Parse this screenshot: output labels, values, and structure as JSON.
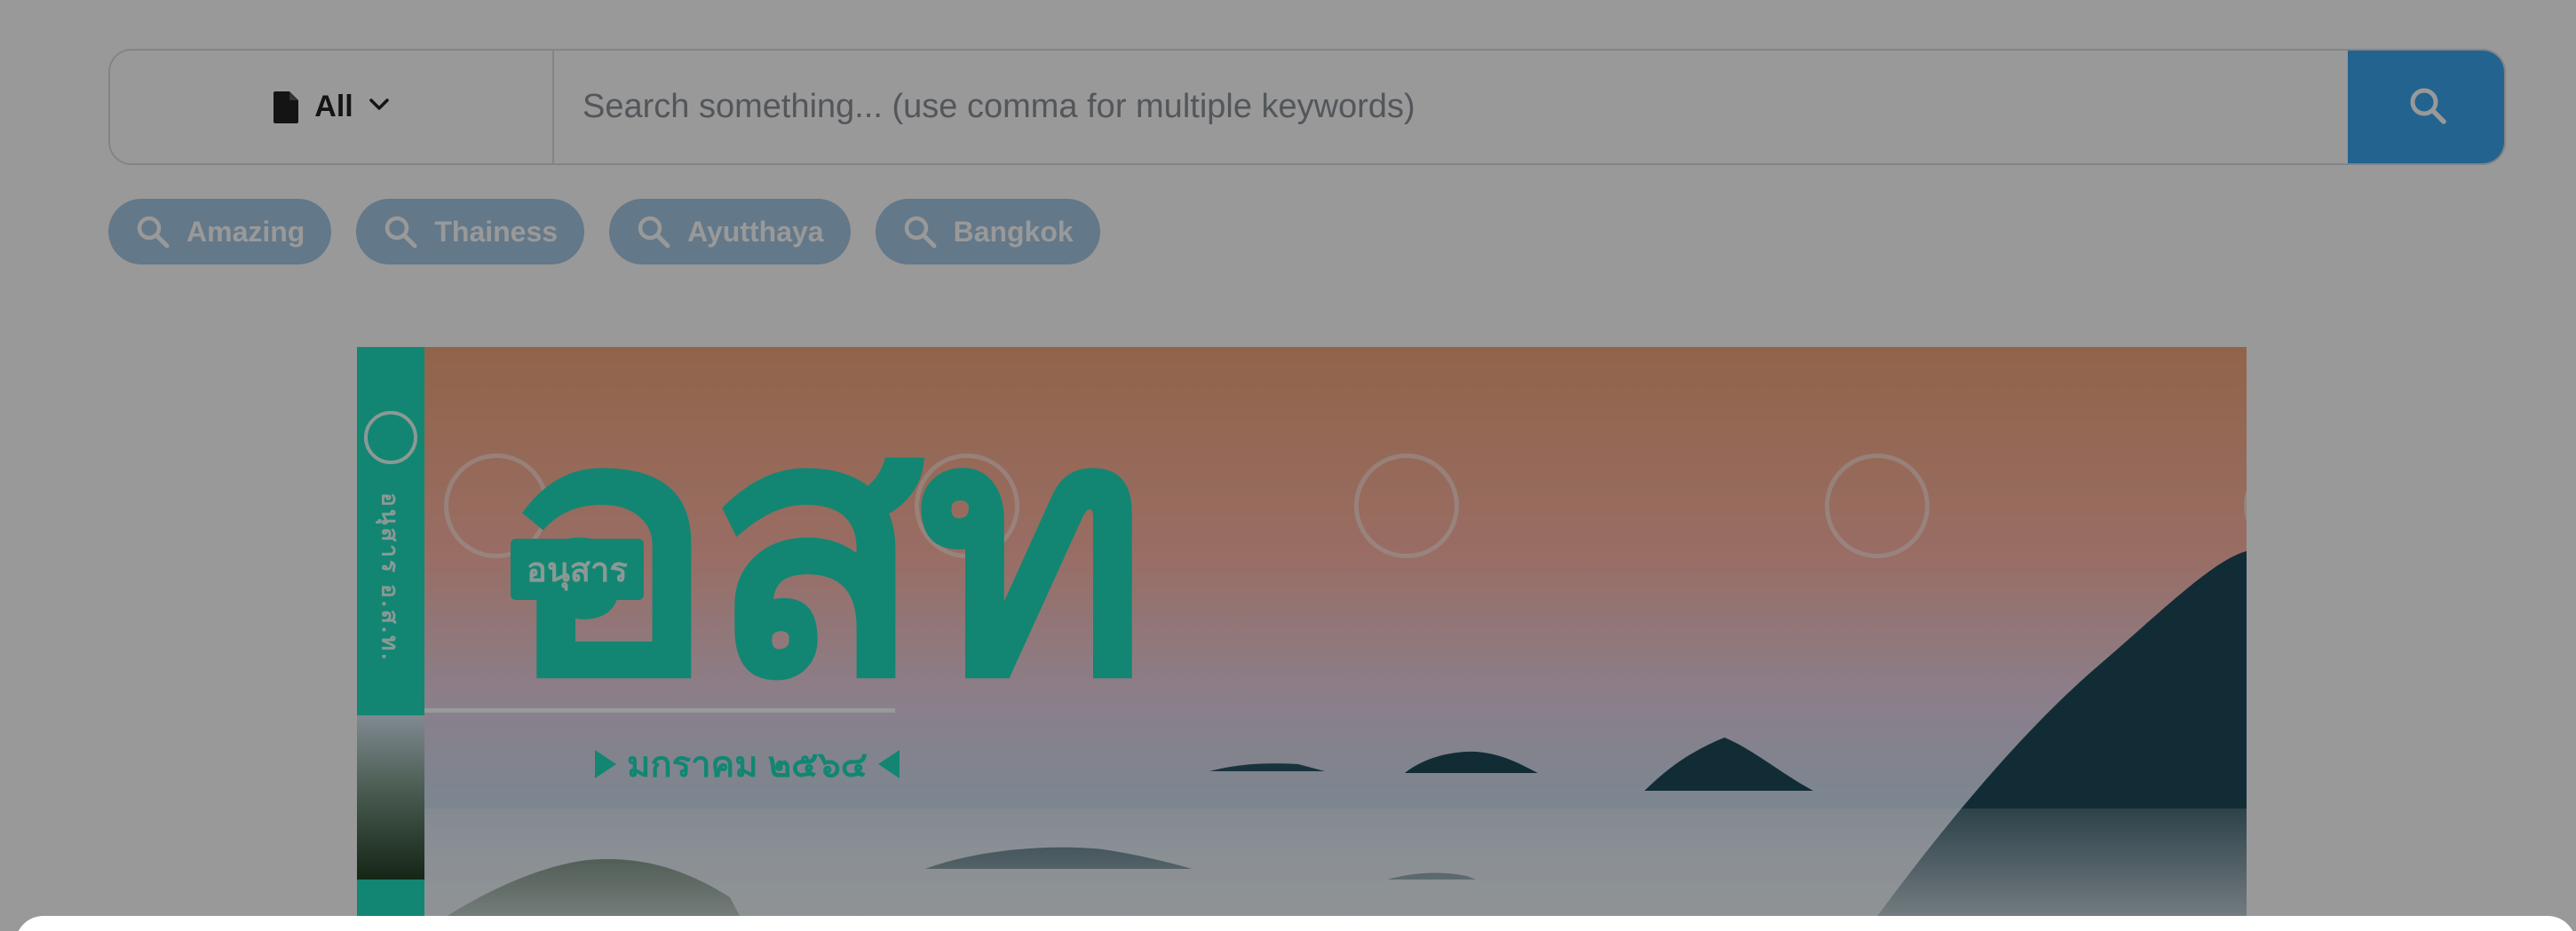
{
  "search": {
    "filter_label": "All",
    "placeholder": "Search something... (use comma for multiple keywords)",
    "value": ""
  },
  "tags": [
    {
      "label": "Amazing"
    },
    {
      "label": "Thainess"
    },
    {
      "label": "Ayutthaya"
    },
    {
      "label": "Bangkok"
    }
  ],
  "cover": {
    "spine_text": "อนุสาร อ.ส.ท.",
    "masthead": "อสท",
    "masthead_sub": "อนุสาร",
    "issue_date": "มกราคม ๒๕๖๔"
  },
  "icons": {
    "filter": "document-icon",
    "dropdown": "chevron-down-icon",
    "search": "search-icon",
    "tag": "search-icon"
  },
  "colors": {
    "primary": "#3ba5ef",
    "tag_bg": "#a6c8e4",
    "brand_teal": "#1fe0bf"
  }
}
